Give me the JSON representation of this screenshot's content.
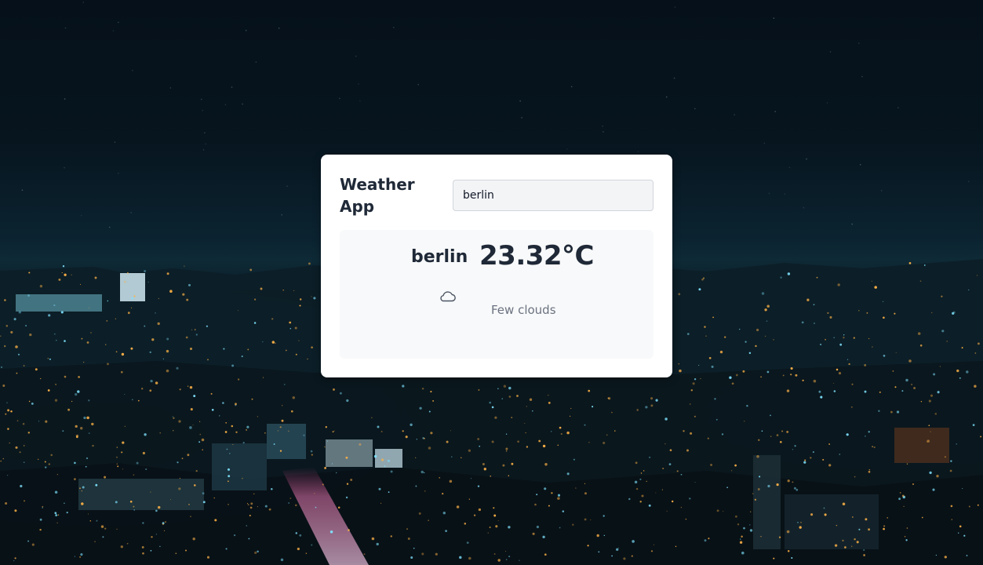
{
  "app": {
    "title": "Weather App"
  },
  "search": {
    "value": "berlin"
  },
  "weather": {
    "city": "berlin",
    "temperature": "23.32°C",
    "description": "Few clouds",
    "icon": "cloud-icon"
  },
  "background": {
    "scene": "city-night-skyline",
    "colors": {
      "sky": "#05101a",
      "horizon": "#0e2a36",
      "lights_warm": "#ffb347",
      "lights_cool": "#7fe3ff"
    }
  }
}
